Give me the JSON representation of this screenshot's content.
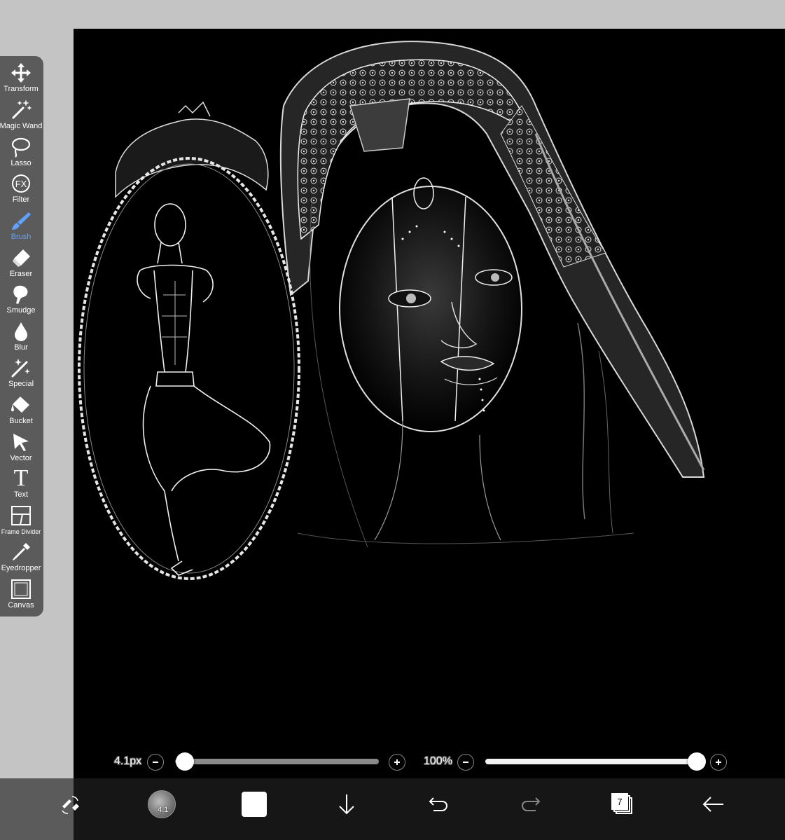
{
  "toolbar": {
    "tools": [
      {
        "label": "Transform",
        "icon": "move-arrows-icon"
      },
      {
        "label": "Magic Wand",
        "icon": "magic-wand-icon"
      },
      {
        "label": "Lasso",
        "icon": "lasso-icon"
      },
      {
        "label": "Filter",
        "icon": "fx-icon"
      },
      {
        "label": "Brush",
        "icon": "brush-icon"
      },
      {
        "label": "Eraser",
        "icon": "eraser-icon"
      },
      {
        "label": "Smudge",
        "icon": "smudge-icon"
      },
      {
        "label": "Blur",
        "icon": "droplet-icon"
      },
      {
        "label": "Special",
        "icon": "sparkle-wand-icon"
      },
      {
        "label": "Bucket",
        "icon": "paint-bucket-icon"
      },
      {
        "label": "Vector",
        "icon": "cursor-arrow-icon"
      },
      {
        "label": "Text",
        "icon": "text-t-icon"
      },
      {
        "label": "Frame Divider",
        "icon": "frame-divider-icon"
      },
      {
        "label": "Eyedropper",
        "icon": "eyedropper-icon"
      },
      {
        "label": "Canvas",
        "icon": "canvas-square-icon"
      }
    ],
    "active_tool": "Brush",
    "fx_text": "FX",
    "text_glyph": "T"
  },
  "sliders": {
    "size": {
      "label": "4.1px",
      "value_fraction": 0.02
    },
    "opacity": {
      "label": "100%",
      "value_fraction": 1.0
    }
  },
  "bottom_bar": {
    "brush_size_badge": "4.1",
    "layer_count": "7",
    "buttons": [
      "swap-tools-icon",
      "brush-preview",
      "color-swatch",
      "download-arrow-icon",
      "undo-icon",
      "redo-icon",
      "layers-icon",
      "back-arrow-icon"
    ]
  },
  "colors": {
    "accent": "#5fa2ff",
    "toolbar_bg": "#5b5b5b",
    "canvas_bg": "#000000",
    "bottom_bar_bg": "#161616",
    "page_bg": "#c4c4c4",
    "current_color": "#ffffff"
  }
}
